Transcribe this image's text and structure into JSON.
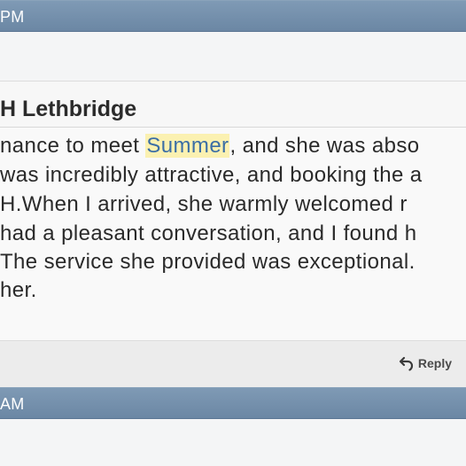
{
  "posts": [
    {
      "time_label": "PM",
      "title": "H Lethbridge",
      "body_lines": [
        {
          "before": "nance to meet ",
          "highlight": "Summer",
          "after": ", and she was abso"
        },
        {
          "before": "was incredibly attractive, and booking the a",
          "highlight": "",
          "after": ""
        },
        {
          "before": "H.When I arrived, she warmly welcomed r",
          "highlight": "",
          "after": ""
        },
        {
          "before": "had a pleasant conversation, and I found h",
          "highlight": "",
          "after": ""
        },
        {
          "before": "The service she provided was exceptional. ",
          "highlight": "",
          "after": ""
        },
        {
          "before": "her.",
          "highlight": "",
          "after": ""
        }
      ],
      "reply_label": "Reply",
      "reply_icon": "reply-arrow-icon"
    },
    {
      "time_label": "AM"
    }
  ],
  "colors": {
    "header_bar": "#7390ad",
    "highlight_bg": "#fbf1b1",
    "highlight_text": "#3b6ea5"
  }
}
